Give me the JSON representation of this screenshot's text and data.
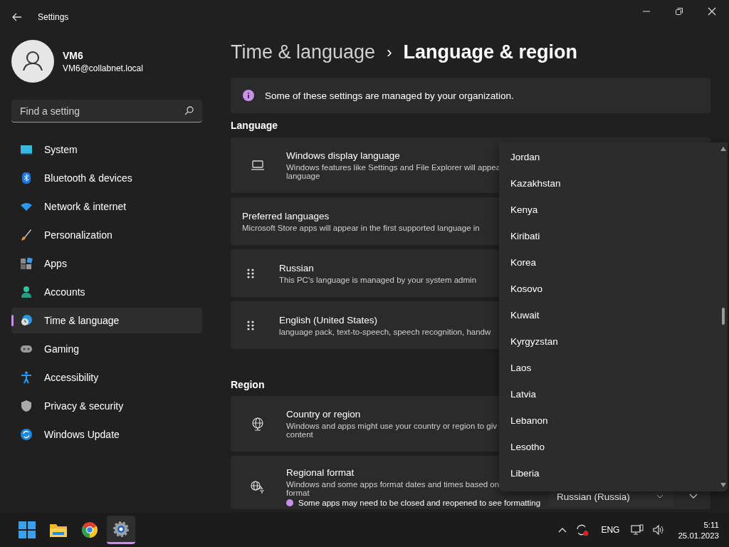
{
  "window": {
    "title": "Settings"
  },
  "profile": {
    "name": "VM6",
    "email": "VM6@collabnet.local"
  },
  "search": {
    "placeholder": "Find a setting"
  },
  "nav": [
    {
      "label": "System",
      "kind": "system",
      "selected": false
    },
    {
      "label": "Bluetooth & devices",
      "kind": "bluetooth",
      "selected": false
    },
    {
      "label": "Network & internet",
      "kind": "network",
      "selected": false
    },
    {
      "label": "Personalization",
      "kind": "brush",
      "selected": false
    },
    {
      "label": "Apps",
      "kind": "apps",
      "selected": false
    },
    {
      "label": "Accounts",
      "kind": "accounts",
      "selected": false
    },
    {
      "label": "Time & language",
      "kind": "time",
      "selected": true
    },
    {
      "label": "Gaming",
      "kind": "gaming",
      "selected": false
    },
    {
      "label": "Accessibility",
      "kind": "accessibility",
      "selected": false
    },
    {
      "label": "Privacy & security",
      "kind": "privacy",
      "selected": false
    },
    {
      "label": "Windows Update",
      "kind": "update",
      "selected": false
    }
  ],
  "breadcrumb": {
    "parent": "Time & language",
    "separator": "›",
    "current": "Language & region"
  },
  "info_bar": {
    "text": "Some of these settings are managed by your organization."
  },
  "sections": [
    {
      "title": "Language",
      "cards": [
        {
          "kind": "display",
          "title": "Windows display language",
          "lines": [
            "Windows features like Settings and File Explorer will appea",
            "language"
          ]
        },
        {
          "kind": "plain",
          "title": "Preferred languages",
          "lines": [
            "Microsoft Store apps will appear in the first supported language in"
          ]
        },
        {
          "kind": "drag",
          "title": "Russian",
          "lines": [
            "This PC's language is managed by your system admin"
          ]
        },
        {
          "kind": "drag",
          "title": "English (United States)",
          "lines": [
            "language pack, text-to-speech, speech recognition, handw"
          ]
        }
      ]
    },
    {
      "title": "Region",
      "cards": [
        {
          "kind": "globe",
          "title": "Country or region",
          "lines": [
            "Windows and apps might use your country or region to giv",
            "content"
          ]
        },
        {
          "kind": "format",
          "title": "Regional format",
          "lines": [
            "Windows and some apps format dates and times based on",
            "format"
          ],
          "note": "Some apps may need to be closed and reopened to see formatting",
          "value": "Russian (Russia)"
        }
      ]
    }
  ],
  "dropdown": {
    "items": [
      "Jordan",
      "Kazakhstan",
      "Kenya",
      "Kiribati",
      "Korea",
      "Kosovo",
      "Kuwait",
      "Kyrgyzstan",
      "Laos",
      "Latvia",
      "Lebanon",
      "Lesotho",
      "Liberia"
    ]
  },
  "taskbar": {
    "apps": [
      {
        "kind": "start",
        "selected": false
      },
      {
        "kind": "folder",
        "selected": false
      },
      {
        "kind": "browser",
        "selected": false
      },
      {
        "kind": "settings",
        "selected": true
      }
    ],
    "language": "ENG",
    "time": "5:11",
    "date": "25.01.2023"
  }
}
